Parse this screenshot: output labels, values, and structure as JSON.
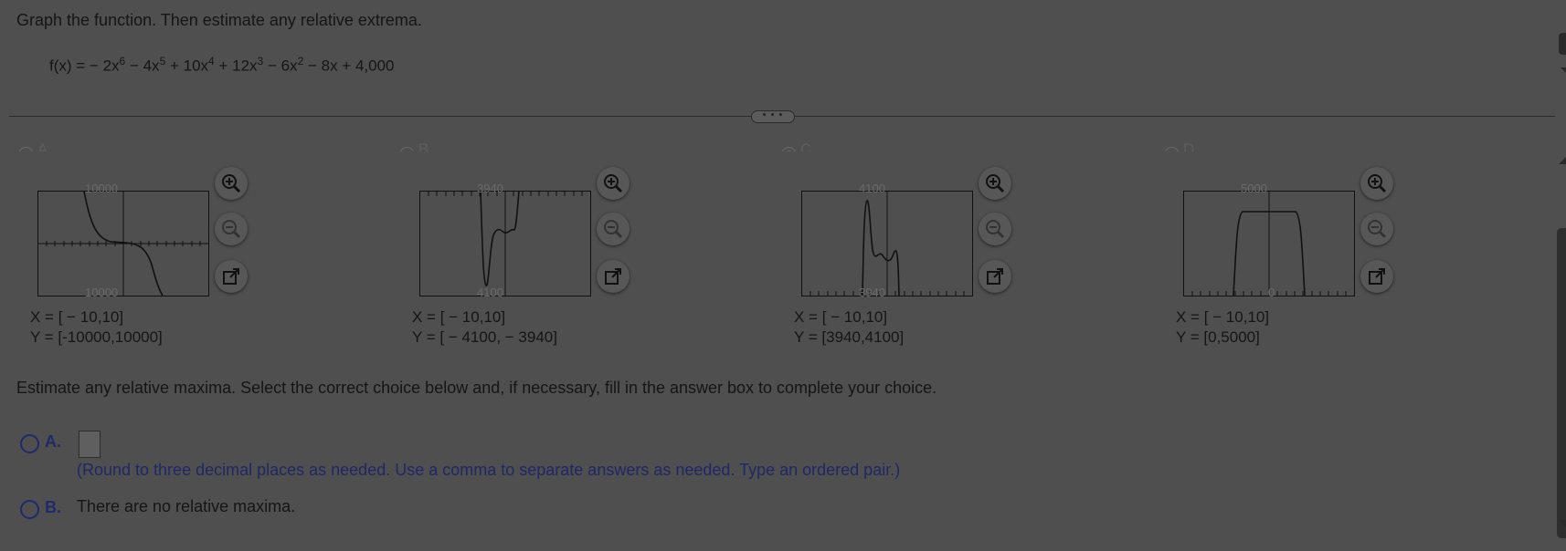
{
  "header": {
    "prompt": "Graph the function. Then estimate any relative extrema.",
    "function_lhs": "f(x) = ",
    "function_terms": [
      "− 2x",
      "6",
      " − 4x",
      "5",
      " + 10x",
      "4",
      " + 12x",
      "3",
      " − 6x",
      "2",
      " − 8x + 4,000"
    ]
  },
  "graph_choices": [
    {
      "label": "A.",
      "top_tick": "10000",
      "bottom_tick": "10000",
      "x_range": "X = [ − 10,10]",
      "y_range": "Y = [-10000,10000]",
      "selected": false
    },
    {
      "label": "B.",
      "top_tick": "3940",
      "bottom_tick": "4100",
      "x_range": "X = [ − 10,10]",
      "y_range": "Y = [ − 4100, − 3940]",
      "selected": false
    },
    {
      "label": "C.",
      "top_tick": "4100",
      "bottom_tick": "3940",
      "x_range": "X = [ − 10,10]",
      "y_range": "Y = [3940,4100]",
      "selected": true
    },
    {
      "label": "D.",
      "top_tick": "5000",
      "bottom_tick": "0",
      "x_range": "X = [ − 10,10]",
      "y_range": "Y = [0,5000]",
      "selected": false
    }
  ],
  "icons": {
    "zoom_in": "zoom-in-icon",
    "zoom_out": "zoom-out-icon",
    "popout": "external-link-icon"
  },
  "question2": {
    "prompt": "Estimate any relative maxima. Select the correct choice below and, if necessary, fill in the answer box to complete your choice.",
    "option_a_letter": "A.",
    "option_a_value": "",
    "option_a_hint": "(Round to three decimal places as needed. Use a comma to separate answers as needed. Type an ordered pair.)",
    "option_b_letter": "B.",
    "option_b_text": "There are no relative maxima."
  },
  "colors": {
    "overlay_background": "#4f4f4f",
    "option_blue": "#1f2a6a"
  }
}
